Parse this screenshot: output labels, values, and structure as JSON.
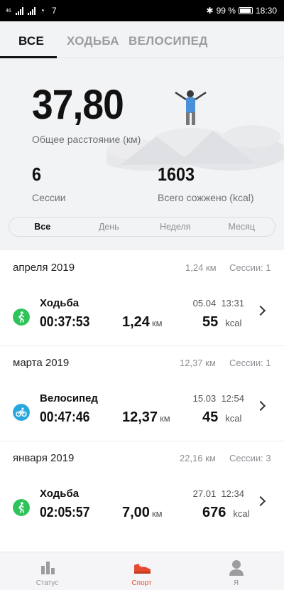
{
  "status_bar": {
    "left_text_1": "46",
    "left_text_2": "7",
    "battery_percent": "99 %",
    "time": "18:30"
  },
  "tabs": [
    {
      "label": "ВСЕ",
      "active": true
    },
    {
      "label": "ХОДЬБА",
      "active": false
    },
    {
      "label": "ВЕЛОСИПЕД",
      "active": false
    }
  ],
  "summary": {
    "total_distance": "37,80",
    "total_distance_label": "Общее расстояние (км)",
    "sessions": "6",
    "sessions_label": "Сессии",
    "calories": "1603",
    "calories_label": "Всего сожжено (kcal)"
  },
  "period_filter": {
    "options": [
      "Все",
      "День",
      "Неделя",
      "Месяц"
    ],
    "selected": "Все"
  },
  "groups": [
    {
      "month": "апреля 2019",
      "distance": "1,24 км",
      "sessions": "Сессии: 1",
      "items": [
        {
          "type": "Ходьба",
          "icon": "walking-icon",
          "color": "#2ec45a",
          "date": "05.04",
          "time": "13:31",
          "duration": "00:37:53",
          "distance": "1,24",
          "distance_unit": "км",
          "kcal": "55",
          "kcal_unit": "kcal"
        }
      ]
    },
    {
      "month": "марта 2019",
      "distance": "12,37 км",
      "sessions": "Сессии: 1",
      "items": [
        {
          "type": "Велосипед",
          "icon": "cycling-icon",
          "color": "#29a8e0",
          "date": "15.03",
          "time": "12:54",
          "duration": "00:47:46",
          "distance": "12,37",
          "distance_unit": "км",
          "kcal": "45",
          "kcal_unit": "kcal"
        }
      ]
    },
    {
      "month": "января 2019",
      "distance": "22,16 км",
      "sessions": "Сессии: 3",
      "items": [
        {
          "type": "Ходьба",
          "icon": "walking-icon",
          "color": "#2ec45a",
          "date": "27.01",
          "time": "12:34",
          "duration": "02:05:57",
          "distance": "7,00",
          "distance_unit": "км",
          "kcal": "676",
          "kcal_unit": "kcal"
        }
      ]
    }
  ],
  "bottom_nav": [
    {
      "label": "Статус",
      "icon": "bar-chart-icon",
      "active": false
    },
    {
      "label": "Спорт",
      "icon": "sneaker-icon",
      "active": true
    },
    {
      "label": "Я",
      "icon": "person-icon",
      "active": false
    }
  ],
  "colors": {
    "accent": "#e64a2e",
    "walking": "#2ec45a",
    "cycling": "#29a8e0"
  }
}
